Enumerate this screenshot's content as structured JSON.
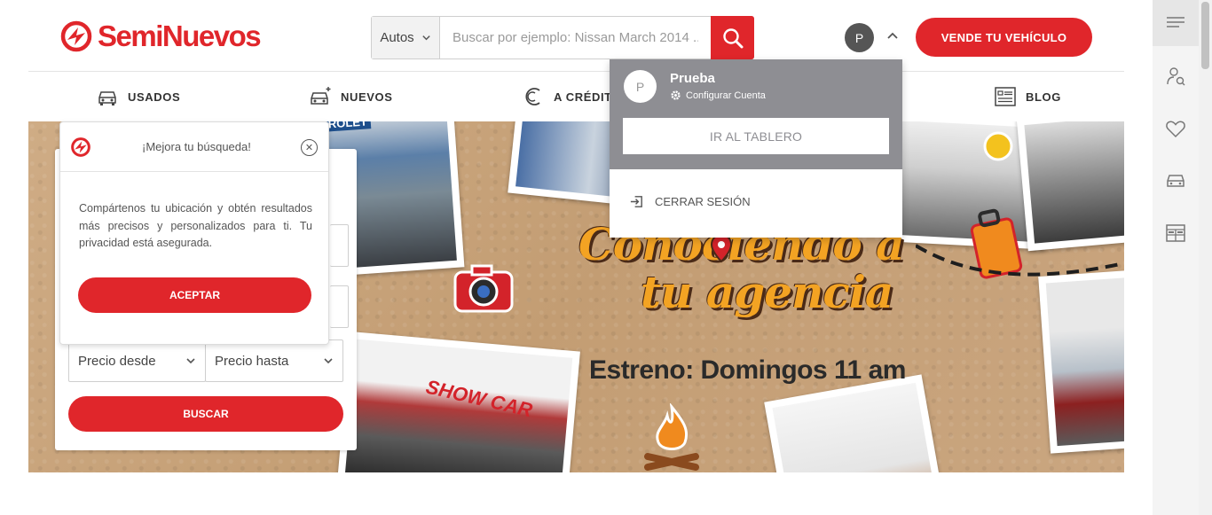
{
  "header": {
    "logo_text": "SemiNuevos",
    "search": {
      "category": "Autos",
      "placeholder": "Buscar por ejemplo: Nissan March 2014 ..."
    },
    "user_initial": "P",
    "sell_button": "VENDE TU VEHÍCULO"
  },
  "nav": {
    "items": [
      {
        "label": "USADOS",
        "icon": "used-car-icon"
      },
      {
        "label": "NUEVOS",
        "icon": "new-car-icon"
      },
      {
        "label": "A CRÉDITO",
        "icon": "credit-icon"
      },
      {
        "label": "BLOG",
        "icon": "blog-icon"
      }
    ]
  },
  "hero": {
    "title_line1": "Conociendo a",
    "title_line2": "tu agencia",
    "subtitle": "Estreno: Domingos 11 am",
    "photo_sign_1": "SHOW CAR",
    "photo_sign_2": "ROLET"
  },
  "search_form": {
    "price_from": "Precio desde",
    "price_to": "Precio hasta",
    "submit": "BUSCAR"
  },
  "location_popup": {
    "title": "¡Mejora tu búsqueda!",
    "text": "Compártenos tu ubicación y obtén resultados más precisos y personalizados para ti. Tu privacidad está asegurada.",
    "accept": "ACEPTAR"
  },
  "user_menu": {
    "initial": "P",
    "name": "Prueba",
    "config": "Configurar Cuenta",
    "dashboard": "IR AL TABLERO",
    "logout": "CERRAR SESIÓN"
  },
  "colors": {
    "brand_red": "#e0262b",
    "menu_gray": "#8e8e93"
  }
}
